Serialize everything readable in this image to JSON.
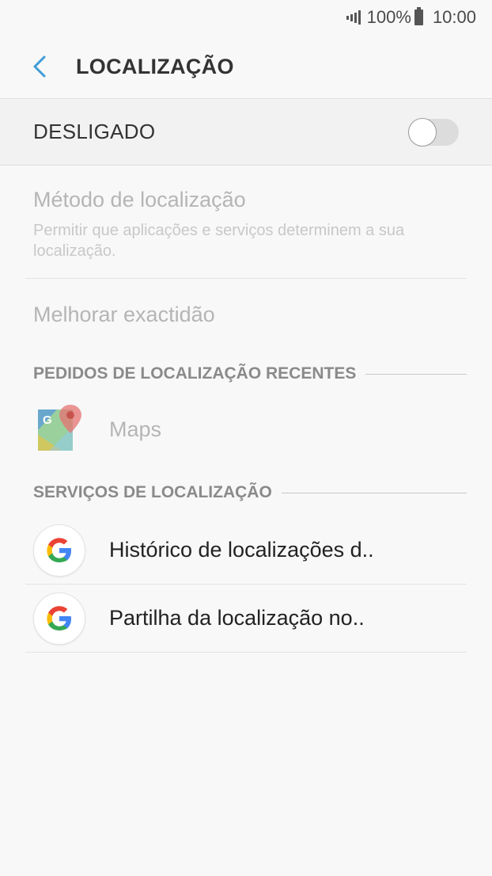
{
  "status_bar": {
    "battery_percent": "100%",
    "time": "10:00"
  },
  "app_bar": {
    "title": "LOCALIZAÇÃO"
  },
  "master_switch": {
    "label": "DESLIGADO",
    "on": false
  },
  "settings": {
    "method": {
      "title": "Método de localização",
      "subtitle": "Permitir que aplicações e serviços determinem a sua localização."
    },
    "accuracy": {
      "title": "Melhorar exactidão"
    }
  },
  "recent_requests": {
    "header": "PEDIDOS DE LOCALIZAÇÃO RECENTES",
    "apps": [
      {
        "name": "Maps",
        "icon": "google-maps-icon"
      }
    ]
  },
  "location_services": {
    "header": "SERVIÇOS DE LOCALIZAÇÃO",
    "items": [
      {
        "name": "Histórico de localizações d..",
        "icon": "google-g-icon"
      },
      {
        "name": "Partilha da localização no..",
        "icon": "google-g-icon"
      }
    ]
  },
  "colors": {
    "accent": "#3f9bd6",
    "background": "#f8f8f8",
    "disabled_text": "#b5b5b5"
  }
}
